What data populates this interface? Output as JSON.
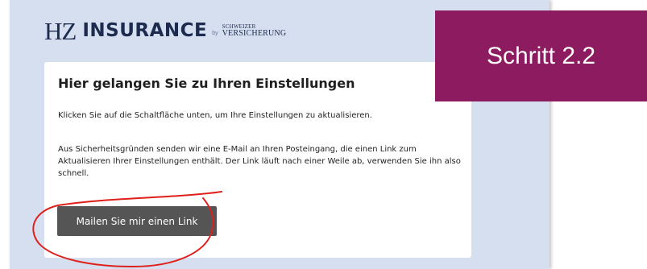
{
  "logo": {
    "mark": "HZ",
    "word": "INSURANCE",
    "by": "by",
    "sub_line1": "SCHWEIZER",
    "sub_line2": "VERSICHERUNG"
  },
  "step_badge": {
    "label": "Schritt 2.2",
    "color": "#8c1b60"
  },
  "card": {
    "title": "Hier gelangen Sie zu Ihren Einstellungen",
    "text_intro": "Klicken Sie auf die Schaltfläche unten, um Ihre Einstellungen zu aktualisieren.",
    "text_security": "Aus Sicherheitsgründen senden wir eine E-Mail an Ihren Posteingang, die einen Link zum Aktualisieren Ihrer Einstellungen enthält. Der Link läuft nach einer Weile ab, verwenden Sie ihn also schnell.",
    "button_label": "Mailen Sie mir einen Link"
  },
  "colors": {
    "page_background": "#d5dff0",
    "button": "#555555",
    "annotation_circle": "#e0201b"
  }
}
